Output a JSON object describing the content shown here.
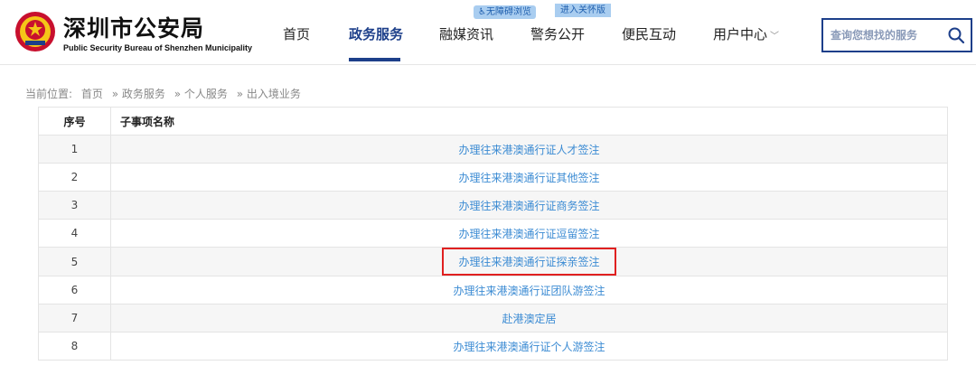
{
  "header": {
    "title": "深圳市公安局",
    "subtitle": "Public Security Bureau of Shenzhen Municipality",
    "accessibility_label": "无障碍浏览",
    "care_label": "进入关怀版",
    "nav": [
      {
        "label": "首页"
      },
      {
        "label": "政务服务"
      },
      {
        "label": "融媒资讯"
      },
      {
        "label": "警务公开"
      },
      {
        "label": "便民互动"
      },
      {
        "label": "用户中心"
      }
    ],
    "search_placeholder": "查询您想找的服务"
  },
  "breadcrumb": {
    "prefix": "当前位置:",
    "items": [
      "首页",
      "» 政务服务",
      "» 个人服务",
      "» 出入境业务"
    ]
  },
  "table": {
    "headers": {
      "no": "序号",
      "name": "子事项名称"
    },
    "rows": [
      {
        "no": "1",
        "name": "办理往来港澳通行证人才签注"
      },
      {
        "no": "2",
        "name": "办理往来港澳通行证其他签注"
      },
      {
        "no": "3",
        "name": "办理往来港澳通行证商务签注"
      },
      {
        "no": "4",
        "name": "办理往来港澳通行证逗留签注"
      },
      {
        "no": "5",
        "name": "办理往来港澳通行证探亲签注"
      },
      {
        "no": "6",
        "name": "办理往来港澳通行证团队游签注"
      },
      {
        "no": "7",
        "name": "赴港澳定居"
      },
      {
        "no": "8",
        "name": "办理往来港澳通行证个人游签注"
      }
    ],
    "highlighted_row": "5"
  },
  "colors": {
    "brand": "#1d3f8a",
    "link": "#3b8bd3",
    "highlight": "#e02020"
  }
}
